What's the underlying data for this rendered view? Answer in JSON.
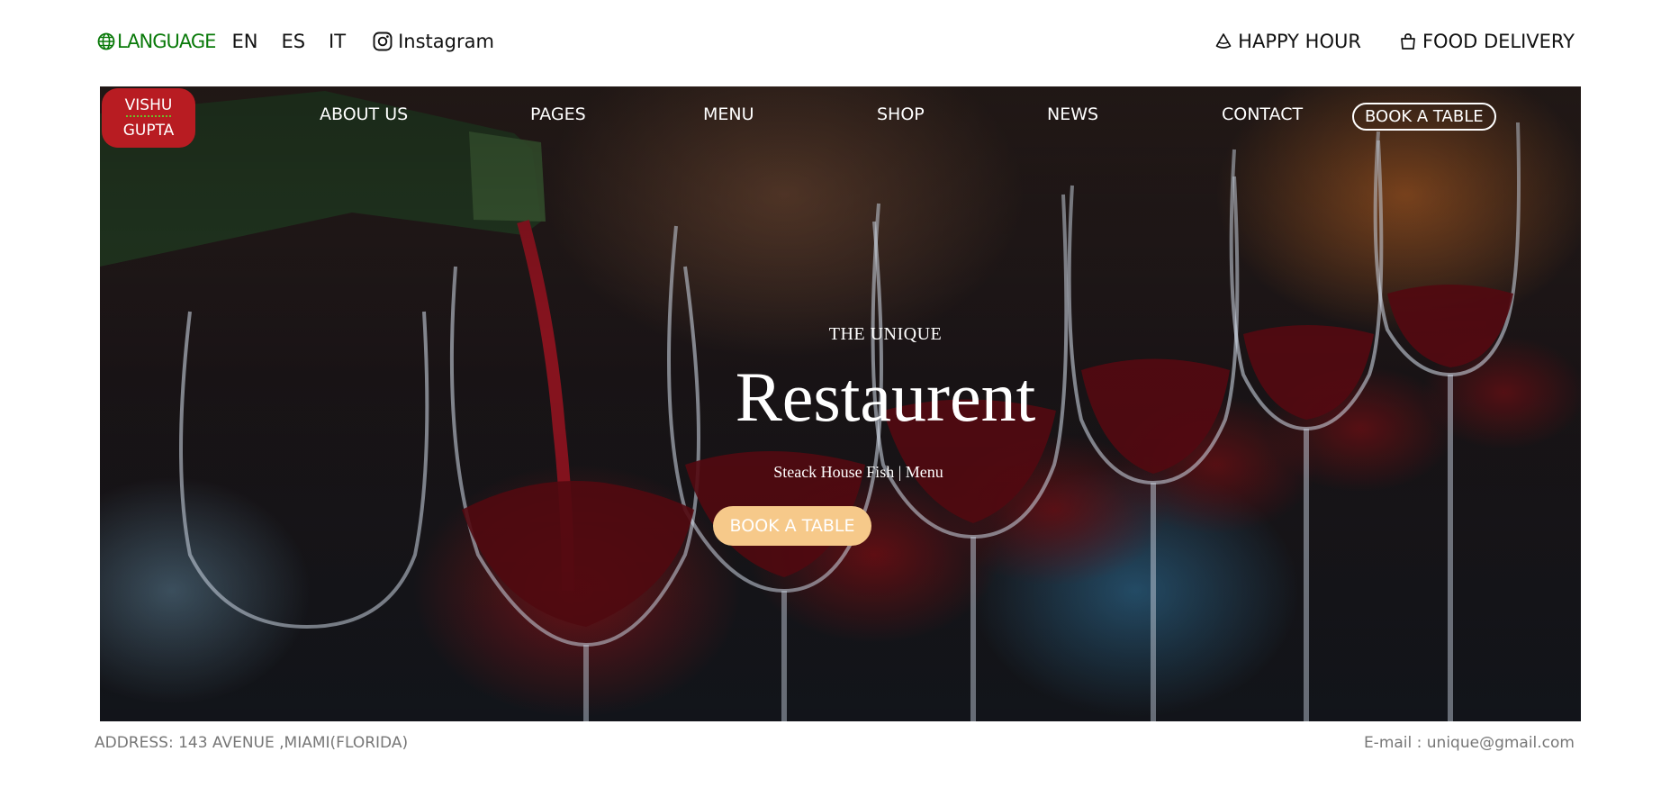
{
  "topbar": {
    "language_label": "LANGUAGE",
    "languages": [
      "EN",
      "ES",
      "IT"
    ],
    "instagram_label": "Instagram",
    "happy_hour_label": "HAPPY HOUR",
    "food_delivery_label": "FOOD DELIVERY",
    "language_color": "#0a7a0a"
  },
  "logo": {
    "line1": "VISHU",
    "line2": "GUPTA",
    "badge_color": "#b81c22"
  },
  "nav": {
    "items": [
      "ABOUT US",
      "PAGES",
      "MENU",
      "SHOP",
      "NEWS",
      "CONTACT"
    ],
    "book_label": "BOOK A TABLE"
  },
  "hero": {
    "subtitle": "THE UNIQUE",
    "title": "Restaurent",
    "tagline": "Steack House Fish | Menu",
    "button_label": "BOOK A TABLE",
    "button_color": "#f6c98a",
    "background": "wine glasses being filled with red wine"
  },
  "footer": {
    "address": "ADDRESS: 143 AVENUE ,MIAMI(FLORIDA)",
    "email": "E-mail : unique@gmail.com"
  },
  "icons": [
    "globe-icon",
    "instagram-icon",
    "cocktail-icon",
    "shopping-bag-icon"
  ]
}
